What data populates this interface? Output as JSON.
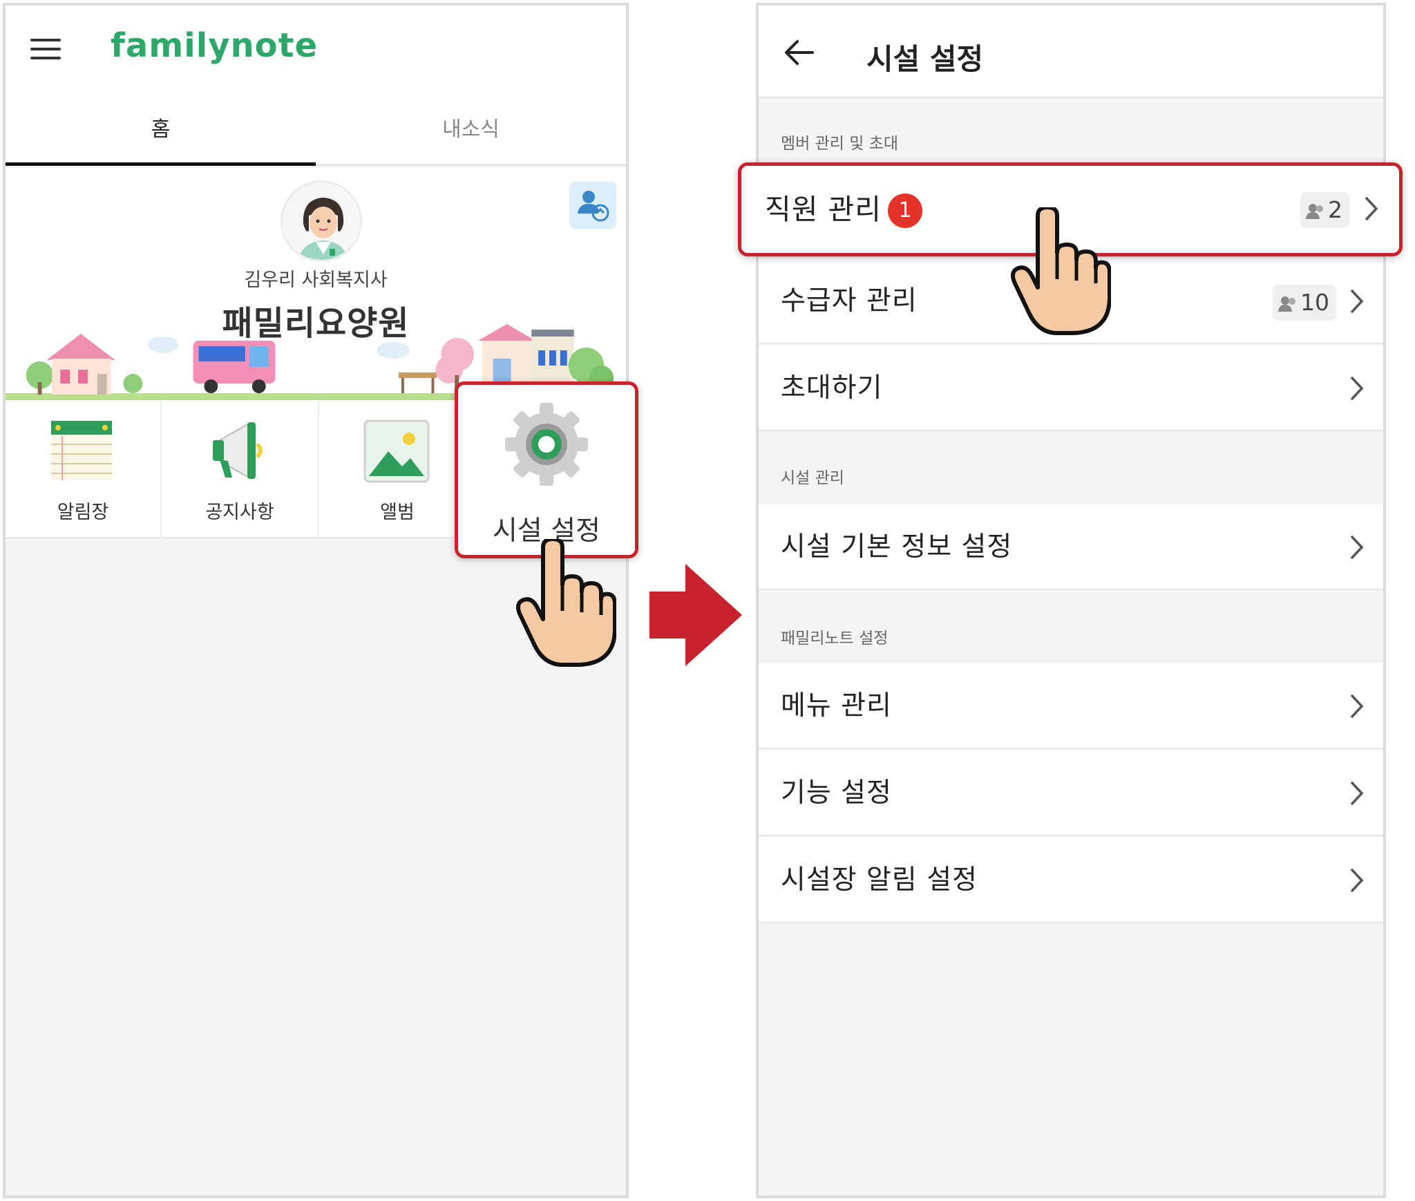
{
  "left_screen": {
    "app_logo": "familynote",
    "tabs": [
      {
        "label": "홈",
        "active": true
      },
      {
        "label": "내소식",
        "active": false
      }
    ],
    "profile": {
      "role": "김우리 사회복지사",
      "facility_name": "패밀리요양원"
    },
    "menu": [
      {
        "label": "알림장",
        "icon": "notebook-icon"
      },
      {
        "label": "공지사항",
        "icon": "megaphone-icon"
      },
      {
        "label": "앨범",
        "icon": "photo-icon"
      },
      {
        "label": "시설 설정",
        "icon": "gear-icon"
      }
    ]
  },
  "right_screen": {
    "title": "시설 설정",
    "sections": [
      {
        "header": "멤버 관리 및 초대",
        "rows": [
          {
            "label": "직원 관리",
            "badge": "1",
            "count": "2"
          },
          {
            "label": "수급자 관리",
            "count": "10"
          },
          {
            "label": "초대하기"
          }
        ]
      },
      {
        "header": "시설 관리",
        "rows": [
          {
            "label": "시설 기본 정보 설정"
          }
        ]
      },
      {
        "header": "패밀리노트 설정",
        "rows": [
          {
            "label": "메뉴 관리"
          },
          {
            "label": "기능 설정"
          },
          {
            "label": "시설장 알림 설정"
          }
        ]
      }
    ]
  },
  "colors": {
    "brand_green": "#2ea86a",
    "highlight_red": "#c8232c",
    "badge_red": "#e63329"
  }
}
